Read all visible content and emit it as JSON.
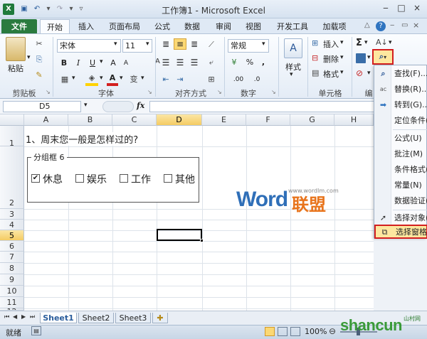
{
  "window": {
    "title": "工作簿1 - Microsoft Excel"
  },
  "tabs": [
    "文件",
    "开始",
    "插入",
    "页面布局",
    "公式",
    "数据",
    "审阅",
    "视图",
    "开发工具",
    "加载项"
  ],
  "clipboard": {
    "paste": "粘贴",
    "label": "剪贴板"
  },
  "font": {
    "name": "宋体",
    "size": "11",
    "bold": "B",
    "italic": "I",
    "underline": "U",
    "color_a": "A",
    "label": "字体"
  },
  "alignment": {
    "label": "对齐方式"
  },
  "number": {
    "format": "常规",
    "percent": "%",
    "comma": ",",
    "label": "数字"
  },
  "styles": {
    "label": "样式",
    "btn": "样式"
  },
  "cells": {
    "insert": "插入",
    "delete": "删除",
    "format": "格式",
    "label": "单元格"
  },
  "editing": {
    "sigma": "Σ",
    "label": "编"
  },
  "formula_bar": {
    "name_box": "D5",
    "fx": "fx",
    "content": ""
  },
  "columns": [
    "A",
    "B",
    "C",
    "D",
    "E",
    "F",
    "G",
    "H"
  ],
  "rows": [
    "1",
    "2",
    "3",
    "4",
    "5",
    "6",
    "7",
    "8",
    "9",
    "10",
    "11",
    "12"
  ],
  "sheet": {
    "question": "1、周末您一般是怎样过的?",
    "group_title": "分组框 6",
    "checkboxes": [
      {
        "label": "休息",
        "checked": true
      },
      {
        "label": "娱乐",
        "checked": false
      },
      {
        "label": "工作",
        "checked": false
      },
      {
        "label": "其他",
        "checked": false
      }
    ]
  },
  "sheet_tabs": [
    "Sheet1",
    "Sheet2",
    "Sheet3"
  ],
  "status": {
    "mode": "就绪",
    "zoom": "100%"
  },
  "menu": {
    "items": [
      "查找(F)...",
      "替换(R)...",
      "转到(G)...",
      "定位条件(S)...",
      "公式(U)",
      "批注(M)",
      "条件格式(C)",
      "常量(N)",
      "数据验证(V)",
      "选择对象(O)",
      "选择窗格(P)..."
    ]
  },
  "watermarks": {
    "word": "Word",
    "lianmeng": "联盟",
    "site": "www.wordlm.com",
    "shancun": "shancun",
    "shancun_sub": "山村网"
  },
  "colors": {
    "file_tab": "#2a7b3f",
    "highlight_border": "#d31f1f",
    "selected_header": "#f5cc63"
  }
}
